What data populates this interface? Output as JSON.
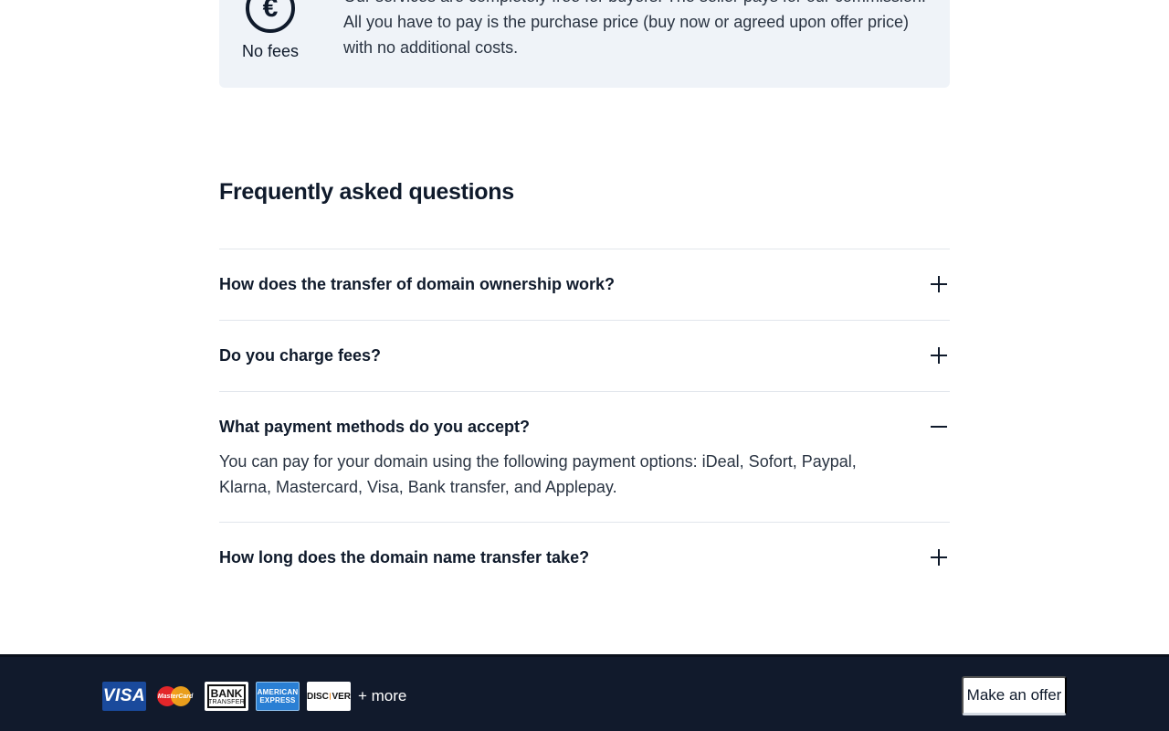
{
  "fees_card": {
    "icon": "euro-icon",
    "icon_glyph": "€",
    "label": "No fees",
    "text": "Our services are completely free for buyers. The seller pays for our commission. All you have to pay is the purchase price (buy now or agreed upon offer price) with no additional costs."
  },
  "faq": {
    "title": "Frequently asked questions",
    "items": [
      {
        "question": "How does the transfer of domain ownership work?",
        "state": "collapsed",
        "toggle_icon": "plus-icon"
      },
      {
        "question": "Do you charge fees?",
        "state": "collapsed",
        "toggle_icon": "plus-icon"
      },
      {
        "question": "What payment methods do you accept?",
        "state": "expanded",
        "toggle_icon": "minus-icon",
        "answer": "You can pay for your domain using the following payment options: iDeal, Sofort, Paypal, Klarna, Mastercard, Visa, Bank transfer, and Applepay."
      },
      {
        "question": "How long does the domain name transfer take?",
        "state": "collapsed",
        "toggle_icon": "plus-icon"
      }
    ]
  },
  "footer": {
    "payment_icons": [
      {
        "name": "visa-icon",
        "text": "VISA"
      },
      {
        "name": "mastercard-icon",
        "text": "MasterCard"
      },
      {
        "name": "bank-transfer-icon",
        "text_top": "BANK",
        "text_bottom": "TRANSFER"
      },
      {
        "name": "american-express-icon",
        "text_top": "AMERICAN",
        "text_bottom": "EXPRESS"
      },
      {
        "name": "discover-icon",
        "text_pre": "DISC",
        "text_post": "VER"
      }
    ],
    "more_label": "+ more",
    "offer_button": "Make an offer"
  },
  "colors": {
    "text_primary": "#0f1a2b",
    "card_bg": "#eff3f8",
    "footer_bg": "#111a2c"
  }
}
